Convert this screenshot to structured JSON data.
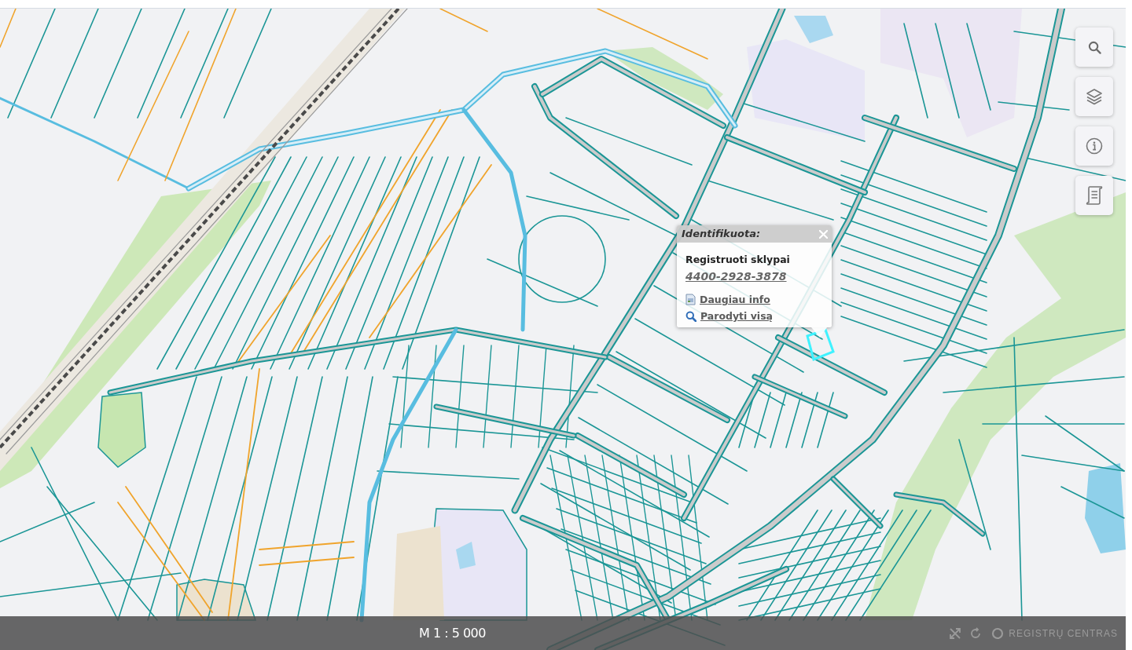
{
  "toolbar": [
    {
      "kind": "search"
    },
    {
      "kind": "layers"
    },
    {
      "kind": "info"
    },
    {
      "kind": "legend"
    }
  ],
  "popup": {
    "title": "Identifikuota:",
    "layer": "Registruoti sklypai",
    "parcel_number": "4400-2928-3878",
    "links": [
      {
        "kind": "details",
        "label": "Daugiau info"
      },
      {
        "kind": "zoom",
        "label": "Parodyti visą"
      }
    ]
  },
  "status_bar": {
    "scale": "M 1 : 5 000",
    "tools": [
      {
        "kind": "expand"
      },
      {
        "kind": "locate"
      }
    ],
    "logo": "REGISTRŲ CENTRAS"
  }
}
